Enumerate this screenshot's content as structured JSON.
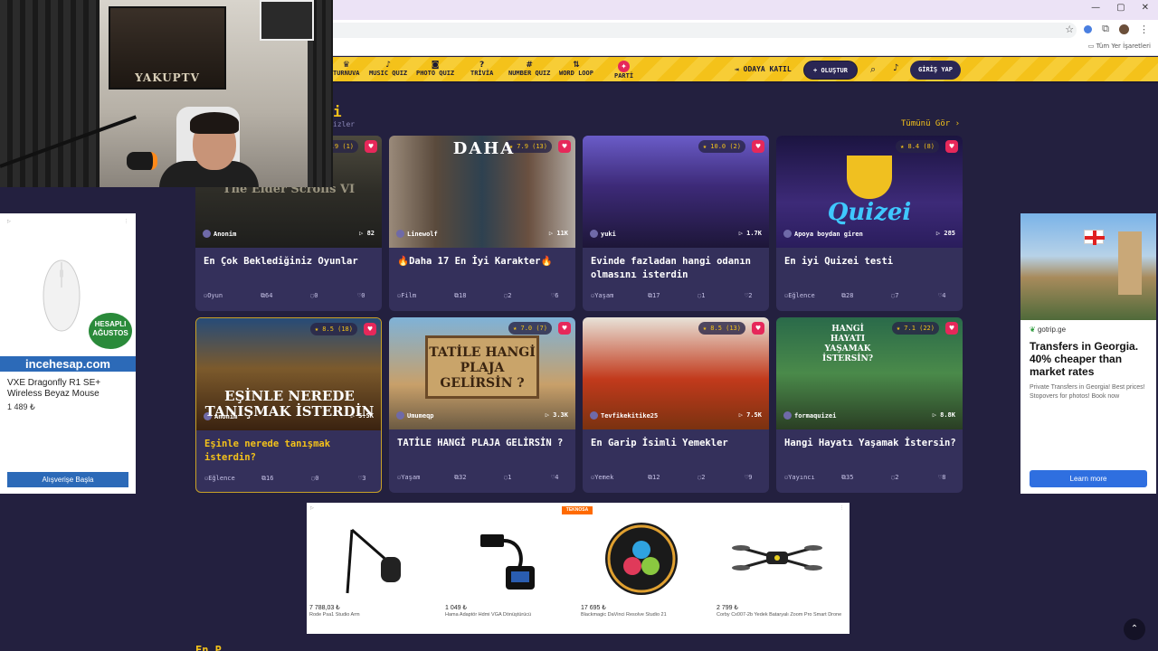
{
  "browser": {
    "bookmarks_all": "Tüm Yer İşaretleri",
    "icons": [
      "star-icon",
      "extension-icon",
      "puzzle-icon",
      "avatar",
      "menu-icon"
    ]
  },
  "nav": {
    "items": [
      {
        "label": "TURNUVA",
        "icon": "trophy-icon",
        "glyph": "♛"
      },
      {
        "label": "MUSIC QUIZ",
        "icon": "music-icon",
        "glyph": "♪"
      },
      {
        "label": "PHOTO QUIZ",
        "icon": "camera-icon",
        "glyph": "◙"
      },
      {
        "label": "TRİVİA",
        "icon": "question-icon",
        "glyph": "?"
      },
      {
        "label": "NUMBER QUIZ",
        "icon": "hash-icon",
        "glyph": "#"
      },
      {
        "label": "WORD LOOP",
        "icon": "sort-icon",
        "glyph": "⇅"
      },
      {
        "label": "PARTİ",
        "icon": "party-icon",
        "glyph": "✦"
      }
    ],
    "join_room": "ODAYA KATIL",
    "create": "+ OLUŞTUR",
    "login": "GİRİŞ YAP",
    "join_glyph": "⇥",
    "search_glyph": "⌕",
    "bell_glyph": "♪"
  },
  "section": {
    "title": "i",
    "subtitle": "izler",
    "see_all": "Tümünü Gör ›"
  },
  "cards": [
    {
      "rating": "★ 9.9 (1)",
      "author": "Anonim",
      "plays": "▷ 82",
      "title": "En Çok Beklediğiniz Oyunlar",
      "category": "Oyun",
      "questions": "64",
      "comments": "0",
      "likes": "0",
      "overlay": "The Elder Scrolls VI"
    },
    {
      "rating": "★ 7.9 (13)",
      "author": "Linewolf",
      "plays": "▷ 11K",
      "title": "🔥Daha 17 En İyi Karakter🔥",
      "category": "Film",
      "questions": "18",
      "comments": "2",
      "likes": "6",
      "overlay": "DAHA"
    },
    {
      "rating": "★ 10.0 (2)",
      "author": "yuki",
      "plays": "▷ 1.7K",
      "title": "Evinde fazladan hangi odanın olmasını isterdin",
      "category": "Yaşam",
      "questions": "17",
      "comments": "1",
      "likes": "2",
      "overlay": ""
    },
    {
      "rating": "★ 8.4 (8)",
      "author": "Apoya boydan giren",
      "plays": "▷ 285",
      "title": "En iyi Quizei testi",
      "category": "Eğlence",
      "questions": "28",
      "comments": "7",
      "likes": "4",
      "overlay": "Quizei"
    },
    {
      "rating": "★ 8.5 (18)",
      "author": "Anonim",
      "plays": "▷ 5.5K",
      "title": "Eşinle nerede tanışmak isterdin?",
      "category": "Eğlence",
      "questions": "16",
      "comments": "0",
      "likes": "3",
      "overlay": "EŞİNLE NEREDE TANIŞMAK İSTERDİN"
    },
    {
      "rating": "★ 7.0 (7)",
      "author": "Umumeqp",
      "plays": "▷ 3.3K",
      "title": "TATİLE HANGİ PLAJA GELİRSİN ?",
      "category": "Yaşam",
      "questions": "32",
      "comments": "1",
      "likes": "4",
      "overlay": "TATİLE HANGİ PLAJA GELİRSİN ?"
    },
    {
      "rating": "★ 8.5 (13)",
      "author": "Tevfikekitike25",
      "plays": "▷ 7.5K",
      "title": "En Garip İsimli Yemekler",
      "category": "Yemek",
      "questions": "12",
      "comments": "2",
      "likes": "9",
      "overlay": ""
    },
    {
      "rating": "★ 7.1 (22)",
      "author": "formaquizei",
      "plays": "▷ 8.8K",
      "title": "Hangi Hayatı Yaşamak İstersin?",
      "category": "Yayıncı",
      "questions": "35",
      "comments": "2",
      "likes": "8",
      "overlay": "HANGİ HAYATI YAŞAMAK İSTERSİN?"
    }
  ],
  "ads": {
    "left": {
      "badge": "HESAPLI AĞUSTOS",
      "brand": "incehesap.com",
      "product": "VXE Dragonfly R1 SE+ Wireless Beyaz Mouse",
      "price": "1 489 ₺",
      "cta": "Alışverişe Başla"
    },
    "right": {
      "domain": "gotrip.ge",
      "title": "Transfers in Georgia. 40% cheaper than market rates",
      "desc": "Private Transfers in Georgia! Best prices! Stopovers for photos! Book now",
      "cta": "Learn more"
    },
    "bottom": {
      "brand": "TEKNOSA",
      "items": [
        {
          "price": "7 788,03 ₺",
          "name": "Rode Psa1 Studio Arm"
        },
        {
          "price": "1 049 ₺",
          "name": "Hama Adaptör Hdmi VGA Dönüştürücü"
        },
        {
          "price": "17 695 ₺",
          "name": "Blackmagic DaVinci Resolve Studio 21"
        },
        {
          "price": "2 799 ₺",
          "name": "Corby Cx007-2b Yedek Bataryalı Zoom Pro Smart Drone"
        }
      ]
    }
  },
  "webcam": {
    "poster": "YAKUPTV"
  },
  "next_section": "En P"
}
